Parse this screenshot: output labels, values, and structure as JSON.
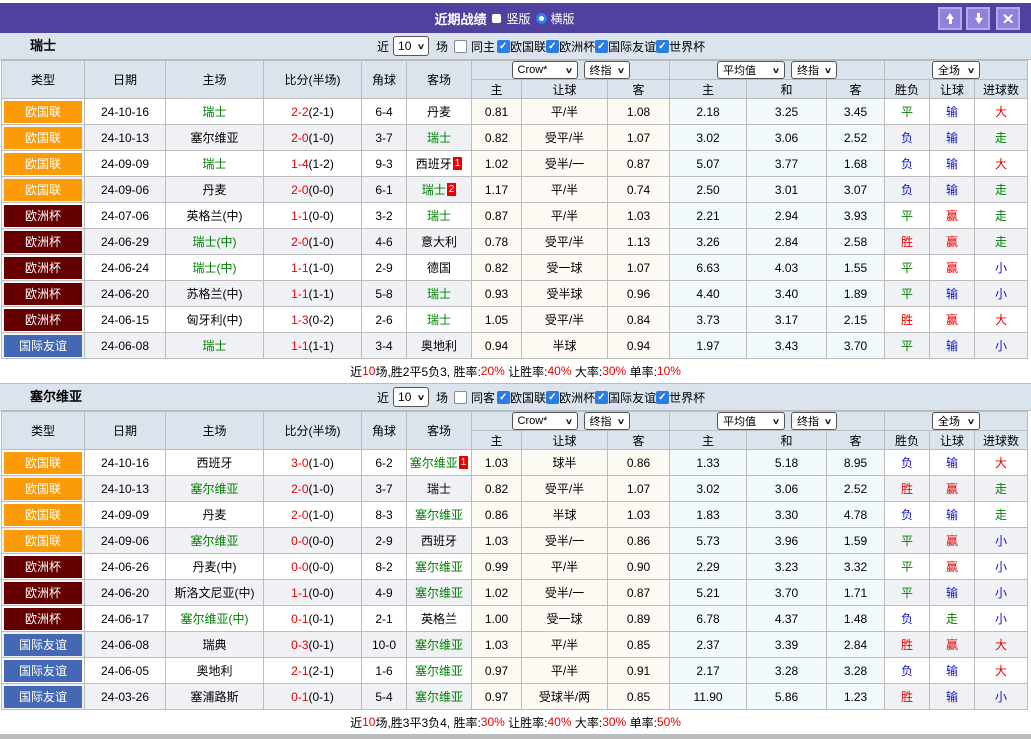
{
  "title_bar": {
    "title": "近期战绩",
    "radio_vertical": "竖版",
    "radio_horizontal": "横版",
    "up_button": "↑",
    "down_button": "↓",
    "close_button": "✕"
  },
  "columns": {
    "type": "类型",
    "date": "日期",
    "home": "主场",
    "score": "比分(半场)",
    "corner": "角球",
    "away": "客场",
    "crow_select": "Crow*",
    "final_select": "终指",
    "avg_select": "平均值",
    "final2_select": "终指",
    "scope_select": "全场",
    "sub": [
      "主",
      "让球",
      "客",
      "主",
      "和",
      "客",
      "胜负",
      "让球",
      "进球数"
    ]
  },
  "filter": {
    "near": "近",
    "count": "10",
    "games": "场",
    "leagues": [
      "欧国联",
      "欧洲杯",
      "国际友谊",
      "世界杯"
    ]
  },
  "league_colors": {
    "欧国联": "#fb9b08",
    "欧洲杯": "#640000",
    "国际友谊": "#4468b4"
  },
  "result_colors": {
    "胜": "red",
    "平": "grn",
    "负": "blu",
    "赢": "red",
    "输": "blu",
    "走": "grn",
    "大": "red",
    "小": "blu"
  },
  "tables": [
    {
      "team": "瑞士",
      "same_label": "同主",
      "rows": [
        [
          "欧国联",
          "24-10-16",
          [
            "瑞士",
            1,
            0
          ],
          [
            "2-2",
            "(2-1)"
          ],
          "6-4",
          [
            "丹麦",
            0,
            0
          ],
          "0.81",
          "平/半",
          "1.08",
          "2.18",
          "3.25",
          "3.45",
          "平",
          "输",
          "大"
        ],
        [
          "欧国联",
          "24-10-13",
          [
            "塞尔维亚",
            0,
            0
          ],
          [
            "2-0",
            "(1-0)"
          ],
          "3-7",
          [
            "瑞士",
            1,
            0
          ],
          "0.82",
          "受平/半",
          "1.07",
          "3.02",
          "3.06",
          "2.52",
          "负",
          "输",
          "走"
        ],
        [
          "欧国联",
          "24-09-09",
          [
            "瑞士",
            1,
            0
          ],
          [
            "1-4",
            "(1-2)"
          ],
          "9-3",
          [
            "西班牙",
            0,
            1
          ],
          "1.02",
          "受半/一",
          "0.87",
          "5.07",
          "3.77",
          "1.68",
          "负",
          "输",
          "大"
        ],
        [
          "欧国联",
          "24-09-06",
          [
            "丹麦",
            0,
            0
          ],
          [
            "2-0",
            "(0-0)"
          ],
          "6-1",
          [
            "瑞士",
            1,
            2
          ],
          "1.17",
          "平/半",
          "0.74",
          "2.50",
          "3.01",
          "3.07",
          "负",
          "输",
          "走"
        ],
        [
          "欧洲杯",
          "24-07-06",
          [
            "英格兰(中)",
            0,
            0
          ],
          [
            "1-1",
            "(0-0)"
          ],
          "3-2",
          [
            "瑞士",
            1,
            0
          ],
          "0.87",
          "平/半",
          "1.03",
          "2.21",
          "2.94",
          "3.93",
          "平",
          "赢",
          "走"
        ],
        [
          "欧洲杯",
          "24-06-29",
          [
            "瑞士(中)",
            1,
            0
          ],
          [
            "2-0",
            "(1-0)"
          ],
          "4-6",
          [
            "意大利",
            0,
            0
          ],
          "0.78",
          "受平/半",
          "1.13",
          "3.26",
          "2.84",
          "2.58",
          "胜",
          "赢",
          "走"
        ],
        [
          "欧洲杯",
          "24-06-24",
          [
            "瑞士(中)",
            1,
            0
          ],
          [
            "1-1",
            "(1-0)"
          ],
          "2-9",
          [
            "德国",
            0,
            0
          ],
          "0.82",
          "受一球",
          "1.07",
          "6.63",
          "4.03",
          "1.55",
          "平",
          "赢",
          "小"
        ],
        [
          "欧洲杯",
          "24-06-20",
          [
            "苏格兰(中)",
            0,
            0
          ],
          [
            "1-1",
            "(1-1)"
          ],
          "5-8",
          [
            "瑞士",
            1,
            0
          ],
          "0.93",
          "受半球",
          "0.96",
          "4.40",
          "3.40",
          "1.89",
          "平",
          "输",
          "小"
        ],
        [
          "欧洲杯",
          "24-06-15",
          [
            "匈牙利(中)",
            0,
            0
          ],
          [
            "1-3",
            "(0-2)"
          ],
          "2-6",
          [
            "瑞士",
            1,
            0
          ],
          "1.05",
          "受平/半",
          "0.84",
          "3.73",
          "3.17",
          "2.15",
          "胜",
          "赢",
          "大"
        ],
        [
          "国际友谊",
          "24-06-08",
          [
            "瑞士",
            1,
            0
          ],
          [
            "1-1",
            "(1-1)"
          ],
          "3-4",
          [
            "奥地利",
            0,
            0
          ],
          "0.94",
          "半球",
          "0.94",
          "1.97",
          "3.43",
          "3.70",
          "平",
          "输",
          "小"
        ]
      ],
      "summary": [
        [
          "近",
          0
        ],
        [
          "10",
          1
        ],
        [
          "场,胜2平5负3, 胜率:",
          0
        ],
        [
          "20%",
          1
        ],
        [
          " 让胜率:",
          0
        ],
        [
          "40%",
          1
        ],
        [
          " 大率:",
          0
        ],
        [
          "30%",
          1
        ],
        [
          " 单率:",
          0
        ],
        [
          "10%",
          1
        ]
      ]
    },
    {
      "team": "塞尔维亚",
      "same_label": "同客",
      "rows": [
        [
          "欧国联",
          "24-10-16",
          [
            "西班牙",
            0,
            0
          ],
          [
            "3-0",
            "(1-0)"
          ],
          "6-2",
          [
            "塞尔维亚",
            1,
            1
          ],
          "1.03",
          "球半",
          "0.86",
          "1.33",
          "5.18",
          "8.95",
          "负",
          "输",
          "大"
        ],
        [
          "欧国联",
          "24-10-13",
          [
            "塞尔维亚",
            1,
            0
          ],
          [
            "2-0",
            "(1-0)"
          ],
          "3-7",
          [
            "瑞士",
            0,
            0
          ],
          "0.82",
          "受平/半",
          "1.07",
          "3.02",
          "3.06",
          "2.52",
          "胜",
          "赢",
          "走"
        ],
        [
          "欧国联",
          "24-09-09",
          [
            "丹麦",
            0,
            0
          ],
          [
            "2-0",
            "(1-0)"
          ],
          "8-3",
          [
            "塞尔维亚",
            1,
            0
          ],
          "0.86",
          "半球",
          "1.03",
          "1.83",
          "3.30",
          "4.78",
          "负",
          "输",
          "走"
        ],
        [
          "欧国联",
          "24-09-06",
          [
            "塞尔维亚",
            1,
            0
          ],
          [
            "0-0",
            "(0-0)"
          ],
          "2-9",
          [
            "西班牙",
            0,
            0
          ],
          "1.03",
          "受半/一",
          "0.86",
          "5.73",
          "3.96",
          "1.59",
          "平",
          "赢",
          "小"
        ],
        [
          "欧洲杯",
          "24-06-26",
          [
            "丹麦(中)",
            0,
            0
          ],
          [
            "0-0",
            "(0-0)"
          ],
          "8-2",
          [
            "塞尔维亚",
            1,
            0
          ],
          "0.99",
          "平/半",
          "0.90",
          "2.29",
          "3.23",
          "3.32",
          "平",
          "赢",
          "小"
        ],
        [
          "欧洲杯",
          "24-06-20",
          [
            "斯洛文尼亚(中)",
            0,
            0
          ],
          [
            "1-1",
            "(0-0)"
          ],
          "4-9",
          [
            "塞尔维亚",
            1,
            0
          ],
          "1.02",
          "受半/一",
          "0.87",
          "5.21",
          "3.70",
          "1.71",
          "平",
          "输",
          "小"
        ],
        [
          "欧洲杯",
          "24-06-17",
          [
            "塞尔维亚(中)",
            1,
            0
          ],
          [
            "0-1",
            "(0-1)"
          ],
          "2-1",
          [
            "英格兰",
            0,
            0
          ],
          "1.00",
          "受一球",
          "0.89",
          "6.78",
          "4.37",
          "1.48",
          "负",
          "走",
          "小"
        ],
        [
          "国际友谊",
          "24-06-08",
          [
            "瑞典",
            0,
            0
          ],
          [
            "0-3",
            "(0-1)"
          ],
          "10-0",
          [
            "塞尔维亚",
            1,
            0
          ],
          "1.03",
          "平/半",
          "0.85",
          "2.37",
          "3.39",
          "2.84",
          "胜",
          "赢",
          "大"
        ],
        [
          "国际友谊",
          "24-06-05",
          [
            "奥地利",
            0,
            0
          ],
          [
            "2-1",
            "(2-1)"
          ],
          "1-6",
          [
            "塞尔维亚",
            1,
            0
          ],
          "0.97",
          "平/半",
          "0.91",
          "2.17",
          "3.28",
          "3.28",
          "负",
          "输",
          "大"
        ],
        [
          "国际友谊",
          "24-03-26",
          [
            "塞浦路斯",
            0,
            0
          ],
          [
            "0-1",
            "(0-1)"
          ],
          "5-4",
          [
            "塞尔维亚",
            1,
            0
          ],
          "0.97",
          "受球半/两",
          "0.85",
          "11.90",
          "5.86",
          "1.23",
          "胜",
          "输",
          "小"
        ]
      ],
      "summary": [
        [
          "近",
          0
        ],
        [
          "10",
          1
        ],
        [
          "场,胜3平3负4, 胜率:",
          0
        ],
        [
          "30%",
          1
        ],
        [
          " 让胜率:",
          0
        ],
        [
          "40%",
          1
        ],
        [
          " 大率:",
          0
        ],
        [
          "30%",
          1
        ],
        [
          " 单率:",
          0
        ],
        [
          "50%",
          1
        ]
      ]
    }
  ]
}
